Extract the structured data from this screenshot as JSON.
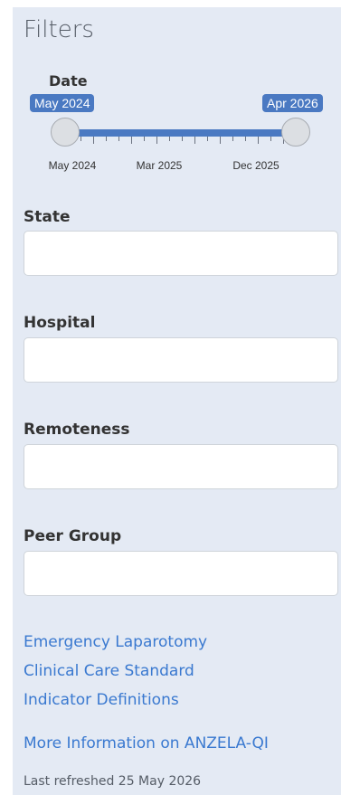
{
  "sidebar": {
    "title": "Filters",
    "date_filter": {
      "label": "Date",
      "start_value": "May 2024",
      "end_value": "Apr 2026",
      "tick_labels": [
        "May 2024",
        "Mar 2025",
        "Dec 2025"
      ]
    },
    "fields": [
      {
        "label": "State",
        "value": "",
        "placeholder": ""
      },
      {
        "label": "Hospital",
        "value": "",
        "placeholder": ""
      },
      {
        "label": "Remoteness",
        "value": "",
        "placeholder": ""
      },
      {
        "label": "Peer Group",
        "value": "",
        "placeholder": ""
      }
    ],
    "links": [
      "Emergency Laparotomy",
      "Clinical Care Standard",
      "Indicator Definitions",
      "More Information on ANZELA-QI"
    ],
    "last_refreshed": "Last refreshed 25 May 2026"
  },
  "colors": {
    "panel_bg": "#e4eaf4",
    "accent": "#4a79c2",
    "link": "#3a79d0"
  }
}
